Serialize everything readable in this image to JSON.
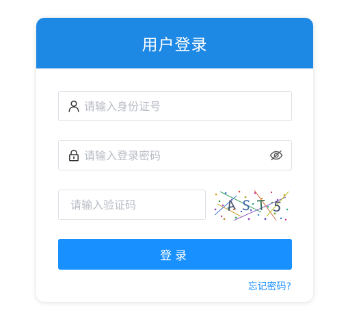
{
  "header": {
    "title": "用户登录"
  },
  "form": {
    "idcard_placeholder": "请输入身份证号",
    "password_placeholder": "请输入登录密码",
    "captcha_placeholder": "请输入验证码",
    "captcha_text": [
      "A",
      "S",
      "T",
      "5"
    ],
    "login_label": "登录",
    "forgot_label": "忘记密码?"
  },
  "icons": {
    "user": "user-icon",
    "lock": "lock-icon",
    "eye": "eye-off-icon"
  },
  "colors": {
    "header_bg": "#1e88e5",
    "button_bg": "#1890ff",
    "link": "#1890ff",
    "border": "#dcdfe6",
    "placeholder": "#b8bcc4"
  }
}
